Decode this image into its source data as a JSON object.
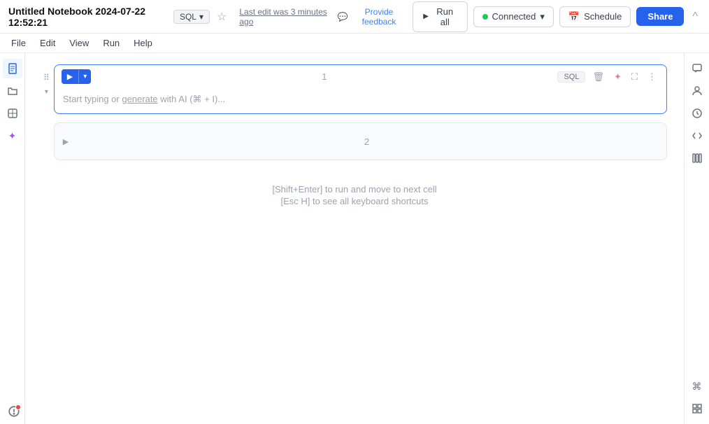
{
  "topbar": {
    "title": "Untitled Notebook 2024-07-22 12:52:21",
    "sql_badge": "SQL",
    "last_edit": "Last edit was 3 minutes ago",
    "feedback_label": "Provide feedback",
    "run_all_label": "Run all",
    "connected_label": "Connected",
    "schedule_label": "Schedule",
    "share_label": "Share",
    "collapse_label": "^"
  },
  "menubar": {
    "items": [
      "File",
      "Edit",
      "View",
      "Run",
      "Help"
    ]
  },
  "cell1": {
    "number": "1",
    "type_badge": "SQL",
    "placeholder_text": "Start typing or ",
    "generate_link": "generate",
    "placeholder_suffix": " with AI (⌘ + I)..."
  },
  "cell2": {
    "number": "2"
  },
  "hints": {
    "line1": "[Shift+Enter] to run and move to next cell",
    "line2": "[Esc H] to see all keyboard shortcuts"
  },
  "sidebar_left": {
    "icons": [
      "document",
      "folder",
      "package",
      "sparkle"
    ]
  },
  "sidebar_right": {
    "icons": [
      "comment",
      "person",
      "history",
      "code",
      "library"
    ]
  },
  "colors": {
    "accent": "#2563eb",
    "connected": "#22c55e",
    "cell_active_border": "#3b82f6"
  }
}
